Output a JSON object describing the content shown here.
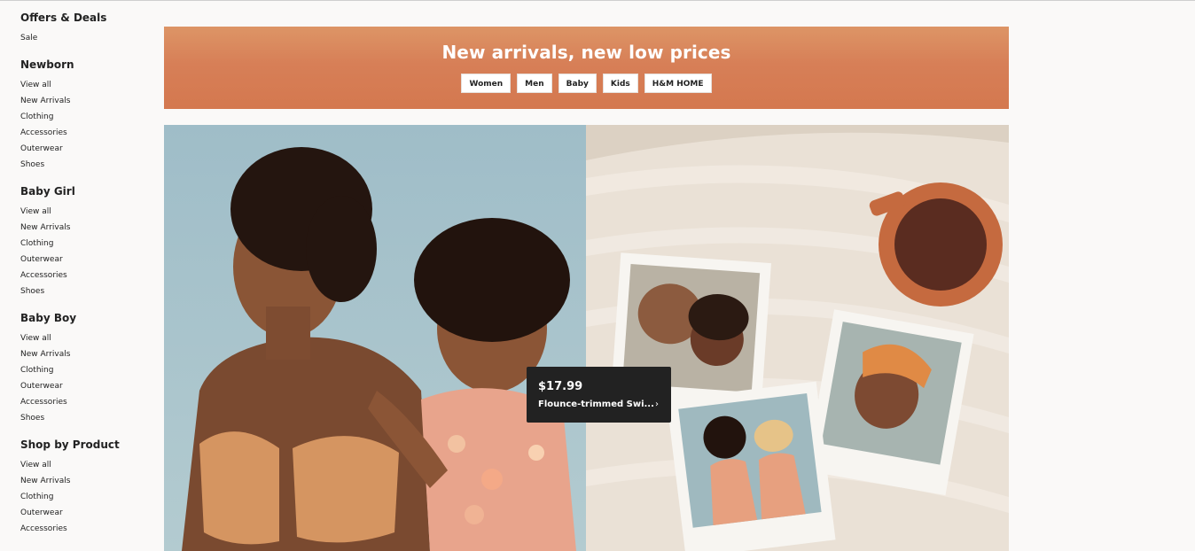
{
  "sidebar": {
    "sections": [
      {
        "title": "Offers & Deals",
        "items": [
          "Sale"
        ]
      },
      {
        "title": "Newborn",
        "items": [
          "View all",
          "New Arrivals",
          "Clothing",
          "Accessories",
          "Outerwear",
          "Shoes"
        ]
      },
      {
        "title": "Baby Girl",
        "items": [
          "View all",
          "New Arrivals",
          "Clothing",
          "Outerwear",
          "Accessories",
          "Shoes"
        ]
      },
      {
        "title": "Baby Boy",
        "items": [
          "View all",
          "New Arrivals",
          "Clothing",
          "Outerwear",
          "Accessories",
          "Shoes"
        ]
      },
      {
        "title": "Shop by Product",
        "items": [
          "View all",
          "New Arrivals",
          "Clothing",
          "Outerwear",
          "Accessories"
        ]
      }
    ]
  },
  "banner": {
    "title": "New arrivals, new low prices",
    "buttons": [
      "Women",
      "Men",
      "Baby",
      "Kids",
      "H&M HOME"
    ],
    "color": "#d77f57"
  },
  "hero": {
    "left_bg": "#a5c0c8",
    "right_bg": "#e9dfd3"
  },
  "product_tooltip": {
    "price": "$17.99",
    "name": "Flounce-trimmed Swi...",
    "arrow_icon": "chevron-right-icon"
  }
}
